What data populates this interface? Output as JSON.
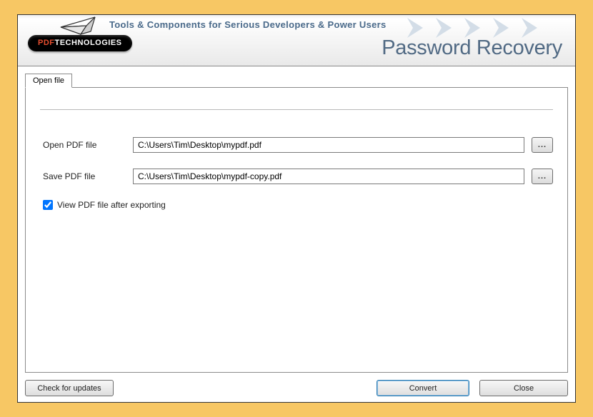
{
  "header": {
    "tagline": "Tools & Components for Serious Developers & Power Users",
    "logo_pdf": "PDF",
    "logo_tech": "TECHNOLOGIES",
    "app_title": "Password Recovery"
  },
  "tab": {
    "label": "Open file"
  },
  "form": {
    "open_label": "Open PDF file",
    "open_value": "C:\\Users\\Tim\\Desktop\\mypdf.pdf",
    "open_browse": "...",
    "save_label": "Save PDF file",
    "save_value": "C:\\Users\\Tim\\Desktop\\mypdf-copy.pdf",
    "save_browse": "...",
    "view_after_label": "View PDF file after exporting",
    "view_after_checked": true
  },
  "footer": {
    "updates": "Check for updates",
    "convert": "Convert",
    "close": "Close"
  }
}
